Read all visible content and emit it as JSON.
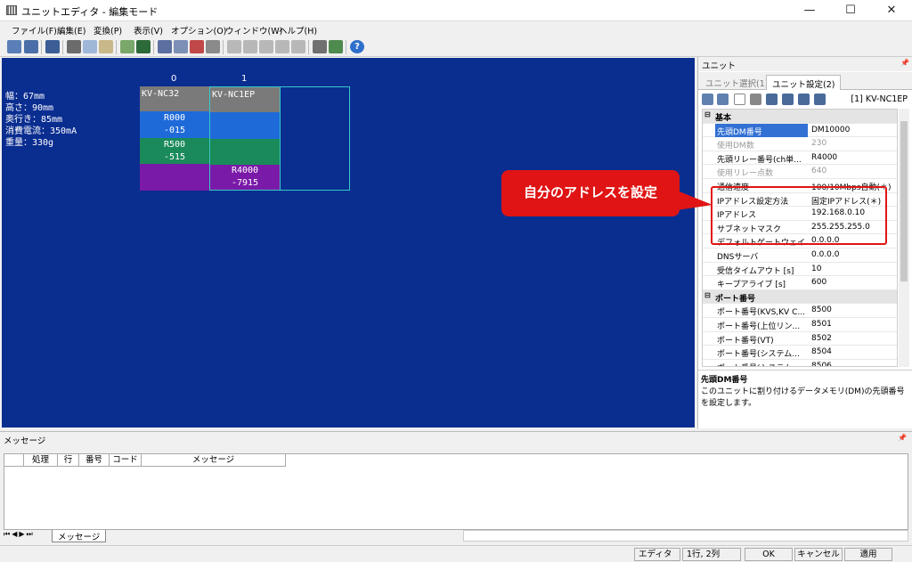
{
  "window": {
    "title": "ユニットエディタ - 編集モード",
    "minimize": "—",
    "maximize": "☐",
    "close": "✕"
  },
  "menu": [
    "ファイル(F)",
    "編集(E)",
    "変換(P)",
    "表示(V)",
    "オプション(O)",
    "ウィンドウ(W)",
    "ヘルプ(H)"
  ],
  "canvas": {
    "col0": "0",
    "col1": "1",
    "specs": [
      "幅：67mm",
      "高さ：90mm",
      "奥行き：85mm",
      "消費電流：350mA",
      "重量：330g"
    ],
    "unit0": {
      "name": "KV-NC32",
      "r1": "R000",
      "r1b": "-015",
      "r2": "R500",
      "r2b": "-515"
    },
    "unit1": {
      "name": "KV-NC1EP",
      "r1": "R4000",
      "r1b": "-7915"
    }
  },
  "callout": "自分のアドレスを設定",
  "panel": {
    "header": "ユニット",
    "pin": "📌",
    "tab1": "ユニット選択(1)",
    "tab2": "ユニット設定(2)",
    "unit_label": "[1] KV-NC1EP",
    "sec_basic": "基本",
    "rows": [
      {
        "k": "先頭DM番号",
        "v": "DM10000"
      },
      {
        "k": "使用DM数",
        "v": "230"
      },
      {
        "k": "先頭リレー番号(ch単...",
        "v": "R4000"
      },
      {
        "k": "使用リレー点数",
        "v": "640"
      },
      {
        "k": "通信速度",
        "v": "100/10Mbps自動(＊)"
      },
      {
        "k": "IPアドレス設定方法",
        "v": "固定IPアドレス(＊)"
      },
      {
        "k": "IPアドレス",
        "v": "192.168.0.10"
      },
      {
        "k": "サブネットマスク",
        "v": "255.255.255.0"
      },
      {
        "k": "デフォルトゲートウェイ",
        "v": "0.0.0.0"
      },
      {
        "k": "DNSサーバ",
        "v": "0.0.0.0"
      },
      {
        "k": "受信タイムアウト [s]",
        "v": "10"
      },
      {
        "k": "キープアライブ [s]",
        "v": "600"
      }
    ],
    "sec_port": "ポート番号",
    "port_rows": [
      {
        "k": "ポート番号(KVS,KV C...",
        "v": "8500"
      },
      {
        "k": "ポート番号(上位リン...",
        "v": "8501"
      },
      {
        "k": "ポート番号(VT)",
        "v": "8502"
      },
      {
        "k": "ポート番号(システム...",
        "v": "8504"
      },
      {
        "k": "ポート番号(システム...",
        "v": "8506"
      }
    ],
    "desc_title": "先頭DM番号",
    "desc_text": "このユニットに割り付けるデータメモリ(DM)の先頭番号を設定します。"
  },
  "messages": {
    "header": "メッセージ",
    "cols": [
      "処理",
      "行",
      "番号",
      "コード",
      "メッセージ"
    ],
    "tab": "メッセージ"
  },
  "status": {
    "mode": "エディタ",
    "pos": "1行, 2列",
    "ok": "OK",
    "cancel": "キャンセル",
    "apply": "適用"
  }
}
